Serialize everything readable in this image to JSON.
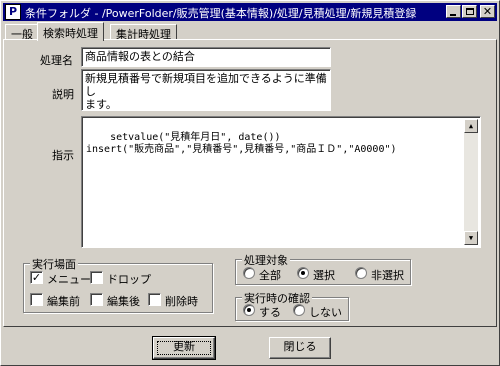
{
  "window": {
    "title": "条件フォルダ - /PowerFolder/販売管理(基本情報)/処理/見積処理/新規見積登録",
    "icon": "P",
    "title_bar_color": "#000080"
  },
  "tabs": [
    {
      "label": "一般",
      "active": false
    },
    {
      "label": "検索時処理",
      "active": true
    },
    {
      "label": "集計時処理",
      "active": false
    }
  ],
  "form": {
    "name_label": "処理名",
    "name_value": "商品情報の表との結合",
    "desc_label": "説明",
    "desc_value": "新規見積番号で新規項目を追加できるように準備し\nます。",
    "command_label": "指示",
    "command_value": "setvalue(\"見積年月日\", date())\ninsert(\"販売商品\",\"見積番号\",見積番号,\"商品ＩＤ\",\"A0000\")"
  },
  "exec_scene": {
    "title": "実行場面",
    "options": [
      {
        "label": "メニュー",
        "checked": true
      },
      {
        "label": "ドロップ",
        "checked": false
      },
      {
        "label": "編集前",
        "checked": false
      },
      {
        "label": "編集後",
        "checked": false
      },
      {
        "label": "削除時",
        "checked": false
      }
    ]
  },
  "target": {
    "title": "処理対象",
    "options": [
      {
        "label": "全部",
        "selected": false
      },
      {
        "label": "選択",
        "selected": true
      },
      {
        "label": "非選択",
        "selected": false
      }
    ]
  },
  "confirm": {
    "title": "実行時の確認",
    "options": [
      {
        "label": "する",
        "selected": true
      },
      {
        "label": "しない",
        "selected": false
      }
    ]
  },
  "buttons": {
    "update": "更新",
    "close": "閉じる"
  },
  "icons": {
    "app": "powerfolder-app-icon",
    "minimize": "minimize-icon",
    "maximize": "maximize-icon",
    "close": "close-icon"
  }
}
